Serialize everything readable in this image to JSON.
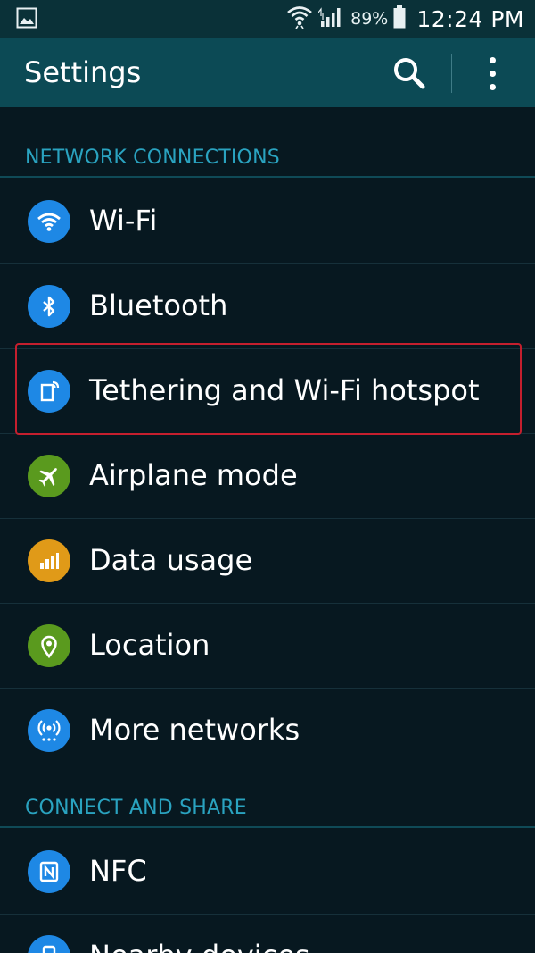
{
  "status_bar": {
    "battery_text": "89%",
    "time": "12:24 PM"
  },
  "app_bar": {
    "title": "Settings"
  },
  "sections": [
    {
      "header": "NETWORK CONNECTIONS",
      "items": [
        {
          "label": "Wi-Fi",
          "icon": "wifi-icon",
          "color": "#1e88e5"
        },
        {
          "label": "Bluetooth",
          "icon": "bluetooth-icon",
          "color": "#1e88e5"
        },
        {
          "label": "Tethering and Wi-Fi hotspot",
          "icon": "tethering-icon",
          "color": "#1e88e5"
        },
        {
          "label": "Airplane mode",
          "icon": "airplane-icon",
          "color": "#5a9a1e"
        },
        {
          "label": "Data usage",
          "icon": "data-usage-icon",
          "color": "#e09a18"
        },
        {
          "label": "Location",
          "icon": "location-icon",
          "color": "#5a9a1e"
        },
        {
          "label": "More networks",
          "icon": "more-networks-icon",
          "color": "#1e88e5"
        }
      ]
    },
    {
      "header": "CONNECT AND SHARE",
      "items": [
        {
          "label": "NFC",
          "icon": "nfc-icon",
          "color": "#1e88e5"
        },
        {
          "label": "Nearby devices",
          "icon": "nearby-devices-icon",
          "color": "#1e88e5"
        }
      ]
    }
  ],
  "colors": {
    "accent": "#2aa3c0",
    "app_bar": "#0c4a55",
    "status_bar": "#0a3138",
    "background": "#071820",
    "highlight": "#c41f2e"
  }
}
